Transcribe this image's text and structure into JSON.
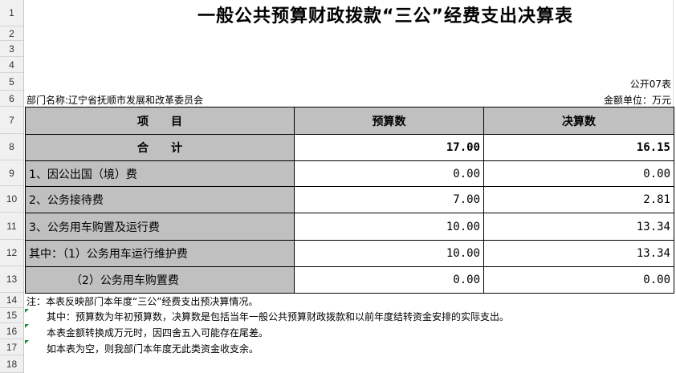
{
  "title": "一般公共预算财政拨款“三公”经费支出决算表",
  "form_code": "公开07表",
  "department": "部门名称:辽宁省抚顺市发展和改革委员会",
  "unit": "金额单位：万元",
  "row_numbers": [
    "1",
    "2",
    "3",
    "4",
    "5",
    "6",
    "7",
    "8",
    "9",
    "10",
    "11",
    "12",
    "13",
    "14",
    "15",
    "16",
    "17",
    "18"
  ],
  "table": {
    "headers": {
      "item": "项　　目",
      "budget": "预算数",
      "actual": "决算数"
    },
    "total": {
      "label": "合　　计",
      "budget": "17.00",
      "actual": "16.15"
    },
    "rows": [
      {
        "label": "1、因公出国（境）费",
        "budget": "0.00",
        "actual": "0.00"
      },
      {
        "label": "2、公务接待费",
        "budget": "7.00",
        "actual": "2.81"
      },
      {
        "label": "3、公务用车购置及运行费",
        "budget": "10.00",
        "actual": "13.34"
      },
      {
        "label": "其中：（1）公务用车运行维护费",
        "budget": "10.00",
        "actual": "13.34"
      },
      {
        "label": "（2）公务用车购置费",
        "budget": "0.00",
        "actual": "0.00"
      }
    ]
  },
  "notes": [
    "注：本表反映部门本年度“三公”经费支出预决算情况。",
    "其中：预算数为年初预算数，决算数是包括当年一般公共预算财政拨款和以前年度结转资金安排的实际支出。",
    "本表金额转换成万元时，因四舍五入可能存在尾差。",
    "如本表为空，则我部门本年度无此类资金收支余。"
  ],
  "colors": {
    "header_fill": "#c0c0c0",
    "row_header_bg": "#f0f0f0",
    "comment_marker": "#1e8c3a"
  }
}
